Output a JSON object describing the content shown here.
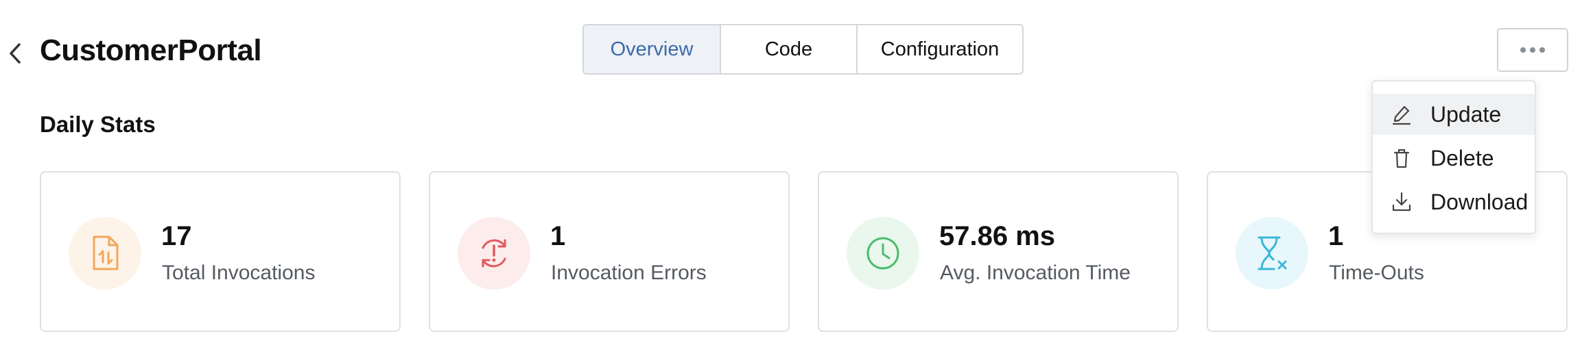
{
  "header": {
    "title": "CustomerPortal",
    "tabs": [
      {
        "label": "Overview",
        "active": true
      },
      {
        "label": "Code",
        "active": false
      },
      {
        "label": "Configuration",
        "active": false
      }
    ]
  },
  "daily_stats": {
    "title": "Daily Stats",
    "cards": [
      {
        "value": "17",
        "label": "Total Invocations",
        "icon": "file-transfer-icon",
        "color": "#f2a65a",
        "bg": "#fdf3e8"
      },
      {
        "value": "1",
        "label": "Invocation Errors",
        "icon": "error-sync-icon",
        "color": "#e2585d",
        "bg": "#fdecec"
      },
      {
        "value": "57.86 ms",
        "label": "Avg. Invocation Time",
        "icon": "clock-icon",
        "color": "#4cbb6c",
        "bg": "#e9f7ed"
      },
      {
        "value": "1",
        "label": "Time-Outs",
        "icon": "hourglass-x-icon",
        "color": "#39b7d8",
        "bg": "#e8f7fc"
      }
    ]
  },
  "menu": {
    "items": [
      {
        "label": "Update",
        "icon": "edit-icon"
      },
      {
        "label": "Delete",
        "icon": "trash-icon"
      },
      {
        "label": "Download",
        "icon": "download-icon"
      }
    ]
  },
  "colors": {
    "accent": "#3b6aa8",
    "active_tab_bg": "#eef1f6",
    "border": "#d3d6db"
  }
}
